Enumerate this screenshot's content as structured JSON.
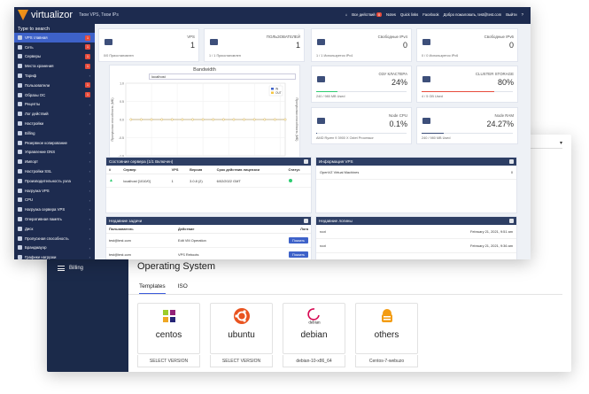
{
  "topbar": {
    "brand": "virtualizor",
    "subtitle": "Твои VPS, Твои IPs",
    "items": [
      "Все действий",
      "Notes",
      "Quick links",
      "Facebook",
      "Добро пожаловать, test@test.com",
      "Выйти"
    ],
    "badge": "0"
  },
  "sidebar": {
    "search_label": "Type to search",
    "items": [
      {
        "label": "VPS главная",
        "count": "1",
        "active": true
      },
      {
        "label": "Сеть",
        "count": "1"
      },
      {
        "label": "Серверы",
        "count": "1"
      },
      {
        "label": "Места хранения",
        "count": "1"
      },
      {
        "label": "Тариф",
        "count": ""
      },
      {
        "label": "Пользователи",
        "count": "1"
      },
      {
        "label": "Образы ОС",
        "count": "1"
      },
      {
        "label": "Рецепты",
        "count": ""
      },
      {
        "label": "Лог действий",
        "count": ""
      },
      {
        "label": "Настройки",
        "count": ""
      },
      {
        "label": "Billing",
        "count": ""
      },
      {
        "label": "Резервное копирование",
        "count": ""
      },
      {
        "label": "Управление DNS",
        "count": ""
      },
      {
        "label": "Импорт",
        "count": ""
      },
      {
        "label": "Настройки SSL",
        "count": ""
      },
      {
        "label": "Производительность узла",
        "count": ""
      },
      {
        "label": "Нагрузка VPS",
        "count": ""
      },
      {
        "label": "CPU",
        "count": ""
      },
      {
        "label": "Нагрузка сервера VPS",
        "count": ""
      },
      {
        "label": "Оперативная память",
        "count": ""
      },
      {
        "label": "Диск",
        "count": ""
      },
      {
        "label": "Пропускная способность",
        "count": ""
      },
      {
        "label": "Брандмауэр",
        "count": ""
      },
      {
        "label": "Графики нагрузки",
        "count": ""
      },
      {
        "label": "Процессы",
        "count": ""
      },
      {
        "label": "Сервисы",
        "count": ""
      },
      {
        "label": "SSH",
        "count": ""
      }
    ]
  },
  "stats": [
    {
      "label": "VPS",
      "value": "1",
      "foot": "0/0 Приостановлен",
      "color": "#3d4f7a"
    },
    {
      "label": "ПОЛЬЗОВАТЕЛЕЙ",
      "value": "1",
      "foot": "1 / 1 Приостановлен",
      "color": "#3d4f7a"
    },
    {
      "label": "Свободные IPv4",
      "value": "0",
      "foot": "1 / 1 Используется IPv4",
      "color": "#3d4f7a"
    },
    {
      "label": "Свободные IPv6",
      "value": "0",
      "foot": "0 / 0 Используется IPv6",
      "color": "#3d4f7a"
    },
    {
      "label": "ОЗУ КЛАСТЕРА",
      "value": "24%",
      "foot": "240 / 980 MB Used",
      "color": "#2ecc71",
      "fill": 0.24
    },
    {
      "label": "CLUSTER STORAGE",
      "value": "80%",
      "foot": "4 / 5 GB Used",
      "color": "#e74c3c",
      "fill": 0.8
    },
    {
      "label": "Node CPU",
      "value": "0.1%",
      "foot": "AMD Ryzen 9 3900 X Octet Processor",
      "color": "#3d4f7a",
      "fill": 0.001
    },
    {
      "label": "Node RAM",
      "value": "24.27%",
      "foot": "240 / 980 MB Used",
      "color": "#3d4f7a",
      "fill": 0.2427
    }
  ],
  "bandwidth": {
    "title": "Bandwidth",
    "select": "localhost",
    "ylabel_left": "Пропускная способность (МБ)",
    "ylabel_right": "Пропускная способность (МБ)",
    "xlabel": "Дата",
    "legend": [
      "IN",
      "OUT"
    ]
  },
  "chart_data": {
    "type": "line",
    "title": "Bandwidth",
    "xlabel": "Дата",
    "ylabel": "Пропускная способность (МБ)",
    "x": [
      1,
      3,
      5,
      7,
      9,
      11,
      13,
      15,
      17,
      19,
      21,
      23,
      25,
      27,
      29,
      31
    ],
    "xticks": [
      "0",
      "5",
      "10",
      "15",
      "20",
      "25",
      "30"
    ],
    "yticks": [
      "1.0",
      "0.5",
      "0.0",
      "-0.5",
      "-1.0"
    ],
    "ylim": [
      -1,
      1
    ],
    "xlim": [
      0,
      31
    ],
    "series": [
      {
        "name": "IN",
        "color": "#3e62c9",
        "values": [
          0,
          0,
          0,
          0,
          0,
          0,
          0,
          0,
          0,
          0,
          0,
          0,
          0,
          0,
          0,
          0
        ]
      },
      {
        "name": "OUT",
        "color": "#f5c542",
        "values": [
          0,
          0,
          0,
          0,
          0,
          0,
          0,
          0,
          0,
          0,
          0,
          0,
          0,
          0,
          0,
          0
        ]
      }
    ],
    "grid": true,
    "legend_position": "top-right"
  },
  "servers": {
    "title": "Состояние сервера (1/1 Включен)",
    "columns": [
      "#",
      "Сервер",
      "VPS",
      "Версия",
      "Срок действия лицензии",
      "Статус"
    ],
    "rows": [
      [
        "",
        "localhost [1010/0]",
        "1",
        "3.0.8 (2)",
        "6/02/2022 GMT",
        ""
      ]
    ]
  },
  "vps_info": {
    "title": "Информация VPS",
    "text": "OpenVZ Virtual Machines",
    "count": "0"
  },
  "tasks": {
    "title": "Недавние задачи",
    "columns": [
      "Пользователь",
      "Действие",
      "Лога"
    ],
    "rows": [
      {
        "user": "test@test.com",
        "action": "Edit VM Operation",
        "button": "Покзать"
      },
      {
        "user": "test@test.com",
        "action": "VPS Reboots",
        "button": "Покзать"
      }
    ]
  },
  "logins": {
    "title": "Недавние логины",
    "rows": [
      {
        "user": "root",
        "time": "February 21, 2021, 9:51 am"
      },
      {
        "user": "root",
        "time": "February 21, 2021, 9:36 am"
      }
    ]
  },
  "billing": {
    "sidebar_label": "Billing",
    "title": "Operating System",
    "tabs": [
      "Templates",
      "ISO"
    ],
    "os": [
      {
        "name": "centos",
        "version": "SELECT VERSION",
        "icon": "centos-icon"
      },
      {
        "name": "ubuntu",
        "version": "SELECT VERSION",
        "icon": "ubuntu-icon"
      },
      {
        "name": "debian",
        "version": "debian-10-x86_64",
        "icon": "debian-icon",
        "logo_text": "debian"
      },
      {
        "name": "others",
        "version": "Centos-7-webuzo",
        "icon": "others-icon"
      }
    ]
  }
}
